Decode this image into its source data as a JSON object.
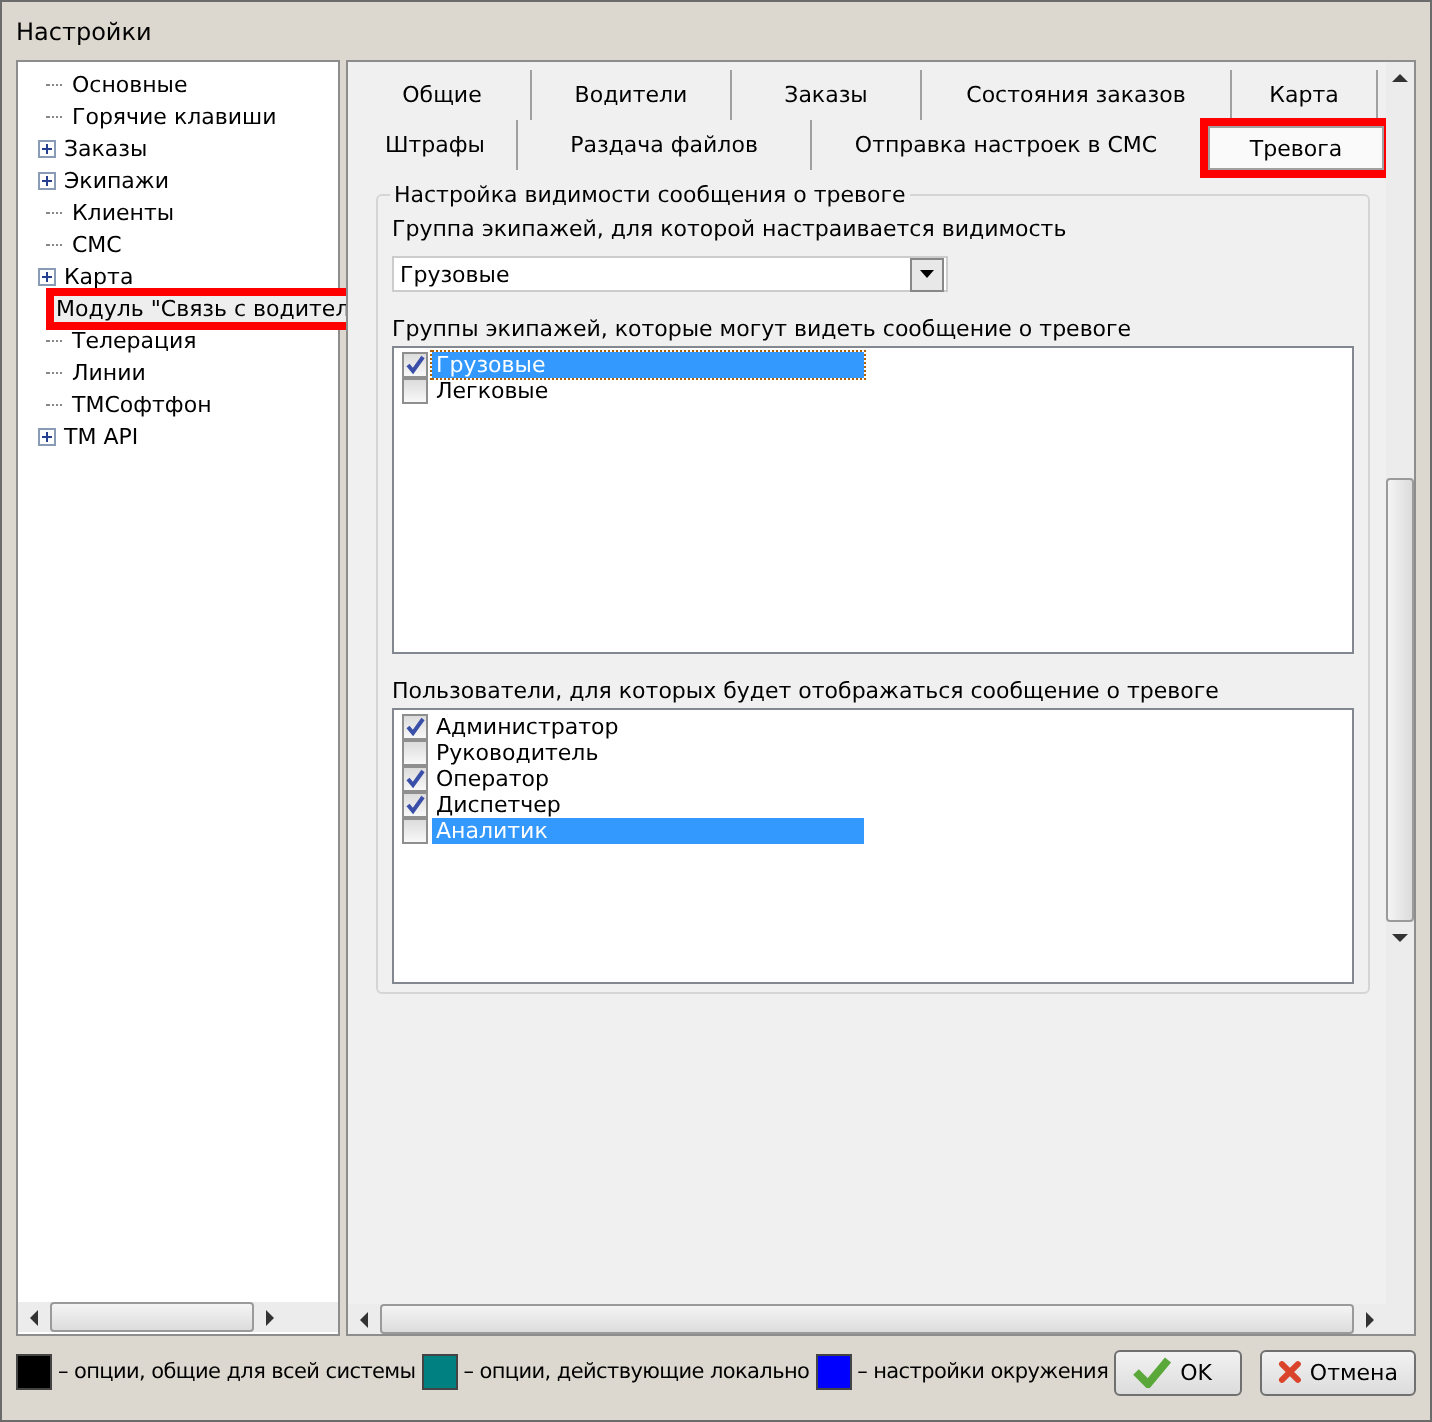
{
  "window": {
    "title": "Настройки"
  },
  "tree": {
    "items": [
      {
        "label": "Основные",
        "expandable": false,
        "highlighted": false
      },
      {
        "label": "Горячие клавиши",
        "expandable": false,
        "highlighted": false
      },
      {
        "label": "Заказы",
        "expandable": true,
        "highlighted": false
      },
      {
        "label": "Экипажи",
        "expandable": true,
        "highlighted": false
      },
      {
        "label": "Клиенты",
        "expandable": false,
        "highlighted": false
      },
      {
        "label": "СМС",
        "expandable": false,
        "highlighted": false
      },
      {
        "label": "Карта",
        "expandable": true,
        "highlighted": false
      },
      {
        "label": "Модуль \"Связь с водител",
        "expandable": false,
        "highlighted": true
      },
      {
        "label": "Телерация",
        "expandable": false,
        "highlighted": false
      },
      {
        "label": "Линии",
        "expandable": false,
        "highlighted": false
      },
      {
        "label": "ТМСофтфон",
        "expandable": false,
        "highlighted": false
      },
      {
        "label": "TM API",
        "expandable": true,
        "highlighted": false
      }
    ]
  },
  "tabs": [
    [
      {
        "label": "Общие",
        "selected": false
      },
      {
        "label": "Водители",
        "selected": false
      },
      {
        "label": "Заказы",
        "selected": false
      },
      {
        "label": "Состояния заказов",
        "selected": false
      },
      {
        "label": "Карта",
        "selected": false
      }
    ],
    [
      {
        "label": "Штрафы",
        "selected": false
      },
      {
        "label": "Раздача файлов",
        "selected": false
      },
      {
        "label": "Отправка настроек в СМС",
        "selected": false
      },
      {
        "label": "Тревога",
        "selected": true,
        "highlighted": true
      }
    ]
  ],
  "group": {
    "title": "Настройка видимости сообщения о тревоге",
    "crew_group_label": "Группа экипажей, для которой настраивается видимость",
    "crew_group_value": "Грузовые",
    "visible_groups_label": "Группы экипажей, которые могут видеть сообщение о тревоге",
    "visible_groups": [
      {
        "label": "Грузовые",
        "checked": true,
        "selected": true
      },
      {
        "label": "Легковые",
        "checked": false,
        "selected": false
      }
    ],
    "users_label": "Пользователи, для которых будет отображаться сообщение о тревоге",
    "users": [
      {
        "label": "Администратор",
        "checked": true,
        "selected": false
      },
      {
        "label": "Руководитель",
        "checked": false,
        "selected": false
      },
      {
        "label": "Оператор",
        "checked": true,
        "selected": false
      },
      {
        "label": "Диспетчер",
        "checked": true,
        "selected": false
      },
      {
        "label": "Аналитик",
        "checked": false,
        "selected": true
      }
    ]
  },
  "legend": [
    {
      "color": "#000000",
      "text": "– опции, общие для всей системы"
    },
    {
      "color": "#008080",
      "text": "– опции, действующие локально"
    },
    {
      "color": "#0000ff",
      "text": "– настройки окружения"
    }
  ],
  "buttons": [
    {
      "label": "OK",
      "kind": "ok"
    },
    {
      "label": "Отмена",
      "kind": "cancel"
    }
  ]
}
